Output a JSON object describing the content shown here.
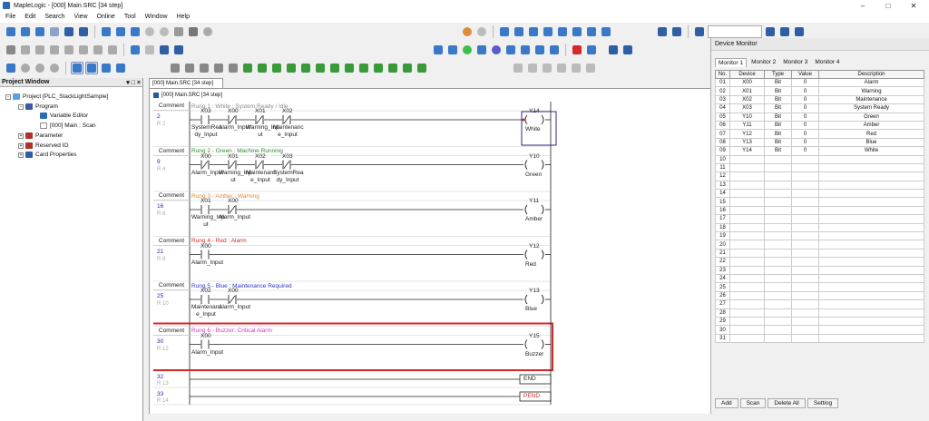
{
  "window": {
    "title": "MapleLogic - [000] Main.SRC [34 step]"
  },
  "menu": [
    "File",
    "Edit",
    "Search",
    "View",
    "Online",
    "Tool",
    "Window",
    "Help"
  ],
  "project_window": {
    "title": "Project Window",
    "pin": "▾ □ ×",
    "items": [
      {
        "label": "Project [PLC_StackLightSample]"
      },
      {
        "label": "Program"
      },
      {
        "label": "Variable Editor"
      },
      {
        "label": "[000] Main : Scan"
      },
      {
        "label": "Parameter"
      },
      {
        "label": "Reserved IO"
      },
      {
        "label": "Card Properties"
      }
    ]
  },
  "editor": {
    "tab_label": "[000] Main.SRC [34 step]",
    "title": "[000] Main.SRC [34 step]",
    "comment_label": "Comment",
    "rungs": [
      {
        "comment": "Rung 1 : White : System Ready / Idle",
        "comment_color": "#8a8a8a",
        "step": "2",
        "r": "R 2",
        "contacts": [
          {
            "dev": "X03",
            "name": "SystemRea dy_Input",
            "nc": false
          },
          {
            "dev": "X00",
            "name": "Alarm_Input",
            "nc": true
          },
          {
            "dev": "X01",
            "name": "Warning_Inp ut",
            "nc": true
          },
          {
            "dev": "X02",
            "name": "Maintenanc e_Input",
            "nc": true
          }
        ],
        "coil": {
          "dev": "Y14",
          "name": "White"
        }
      },
      {
        "comment": "Rung 2 - Green : Machine Running",
        "comment_color": "#2e8b2e",
        "step": "9",
        "r": "R 4",
        "contacts": [
          {
            "dev": "X00",
            "name": "Alarm_Input",
            "nc": true
          },
          {
            "dev": "X01",
            "name": "Warning_Inp ut",
            "nc": true
          },
          {
            "dev": "X02",
            "name": "Maintenanc e_Input",
            "nc": true
          },
          {
            "dev": "X03",
            "name": "SystemRea dy_Input",
            "nc": true
          }
        ],
        "coil": {
          "dev": "Y10",
          "name": "Green"
        }
      },
      {
        "comment": "Rung 3 - Amber : Warning",
        "comment_color": "#e08a3a",
        "step": "16",
        "r": "R 6",
        "contacts": [
          {
            "dev": "X01",
            "name": "Warning_Inp ut",
            "nc": false
          },
          {
            "dev": "X00",
            "name": "Alarm_Input",
            "nc": true
          }
        ],
        "coil": {
          "dev": "Y11",
          "name": "Amber"
        }
      },
      {
        "comment": "Rung 4 - Red : Alarm",
        "comment_color": "#d42a2a",
        "step": "21",
        "r": "R 8",
        "contacts": [
          {
            "dev": "X00",
            "name": "Alarm_Input",
            "nc": false
          }
        ],
        "coil": {
          "dev": "Y12",
          "name": "Red"
        }
      },
      {
        "comment": "Rung 5 - Blue : Maintenance Required",
        "comment_color": "#2a35c4",
        "step": "25",
        "r": "R 10",
        "contacts": [
          {
            "dev": "X02",
            "name": "Maintenanc e_Input",
            "nc": false
          },
          {
            "dev": "X00",
            "name": "Alarm_Input",
            "nc": true
          }
        ],
        "coil": {
          "dev": "Y13",
          "name": "Blue"
        }
      },
      {
        "comment": "Rung 6 - Buzzer: Critical Alarm",
        "comment_color": "#c63ac6",
        "step": "30",
        "r": "R 12",
        "contacts": [
          {
            "dev": "X00",
            "name": "Alarm_Input",
            "nc": false
          }
        ],
        "coil": {
          "dev": "Y15",
          "name": "Buzzer"
        }
      }
    ],
    "end_rows": [
      {
        "step": "32",
        "r": "R 13",
        "instr": "END",
        "color": "#222"
      },
      {
        "step": "33",
        "r": "R 14",
        "instr": "PEND",
        "color": "#d42a2a"
      }
    ],
    "highlight_color": "#d42a2a"
  },
  "device_monitor": {
    "title": "Device Monitor",
    "tabs": [
      "Monitor 1",
      "Monitor 2",
      "Monitor 3",
      "Monitor 4"
    ],
    "columns": [
      "No.",
      "Device",
      "Type",
      "Value",
      "Description"
    ],
    "rows": [
      [
        "01",
        "X00",
        "Bit",
        "0",
        "Alarm"
      ],
      [
        "02",
        "X01",
        "Bit",
        "0",
        "Warning"
      ],
      [
        "03",
        "X02",
        "Bit",
        "0",
        "Maintenance"
      ],
      [
        "04",
        "X03",
        "Bit",
        "0",
        "System Ready"
      ],
      [
        "05",
        "Y10",
        "Bit",
        "0",
        "Green"
      ],
      [
        "06",
        "Y11",
        "Bit",
        "0",
        "Amber"
      ],
      [
        "07",
        "Y12",
        "Bit",
        "0",
        "Red"
      ],
      [
        "08",
        "Y13",
        "Bit",
        "0",
        "Blue"
      ],
      [
        "09",
        "Y14",
        "Bit",
        "0",
        "White"
      ],
      [
        "10",
        "",
        "",
        "",
        ""
      ],
      [
        "11",
        "",
        "",
        "",
        ""
      ],
      [
        "12",
        "",
        "",
        "",
        ""
      ],
      [
        "13",
        "",
        "",
        "",
        ""
      ],
      [
        "14",
        "",
        "",
        "",
        ""
      ],
      [
        "15",
        "",
        "",
        "",
        ""
      ],
      [
        "16",
        "",
        "",
        "",
        ""
      ],
      [
        "17",
        "",
        "",
        "",
        ""
      ],
      [
        "18",
        "",
        "",
        "",
        ""
      ],
      [
        "19",
        "",
        "",
        "",
        ""
      ],
      [
        "20",
        "",
        "",
        "",
        ""
      ],
      [
        "21",
        "",
        "",
        "",
        ""
      ],
      [
        "22",
        "",
        "",
        "",
        ""
      ],
      [
        "23",
        "",
        "",
        "",
        ""
      ],
      [
        "24",
        "",
        "",
        "",
        ""
      ],
      [
        "25",
        "",
        "",
        "",
        ""
      ],
      [
        "26",
        "",
        "",
        "",
        ""
      ],
      [
        "27",
        "",
        "",
        "",
        ""
      ],
      [
        "28",
        "",
        "",
        "",
        ""
      ],
      [
        "29",
        "",
        "",
        "",
        ""
      ],
      [
        "30",
        "",
        "",
        "",
        ""
      ],
      [
        "31",
        "",
        "",
        "",
        ""
      ]
    ],
    "buttons": [
      "Add",
      "Scan",
      "Delete All",
      "Setting"
    ]
  }
}
